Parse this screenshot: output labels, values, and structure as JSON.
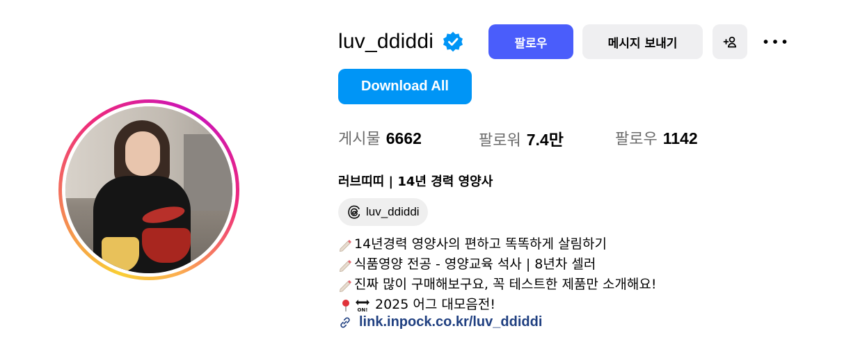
{
  "profile": {
    "username": "luv_ddiddi",
    "verified_icon": "verified-badge-icon",
    "accent_color": "#4a5dfb",
    "download_color": "#0095f6"
  },
  "actions": {
    "follow_label": "팔로우",
    "message_label": "메시지 보내기",
    "add_user_label": "+",
    "more_icon": "more-horizontal-icon",
    "download_label": "Download All"
  },
  "stats": {
    "posts_label": "게시물",
    "posts_value": "6662",
    "followers_label": "팔로워",
    "followers_value": "7.4만",
    "following_label": "팔로우",
    "following_value": "1142"
  },
  "bio": {
    "full_name": "러브띠띠 | 14년 경력 영양사",
    "threads_handle": "luv_ddiddi",
    "lines": [
      "14년경력 영양사의 편하고 똑똑하게 살림하기",
      "식품영양 전공 - 영양교육 석사 | 8년차 셀러",
      "진짜 많이 구매해보구요, 꼭 테스트한 제품만 소개해요!",
      "2025 어그 대모음전!"
    ],
    "link": "link.inpock.co.kr/luv_ddiddi"
  }
}
